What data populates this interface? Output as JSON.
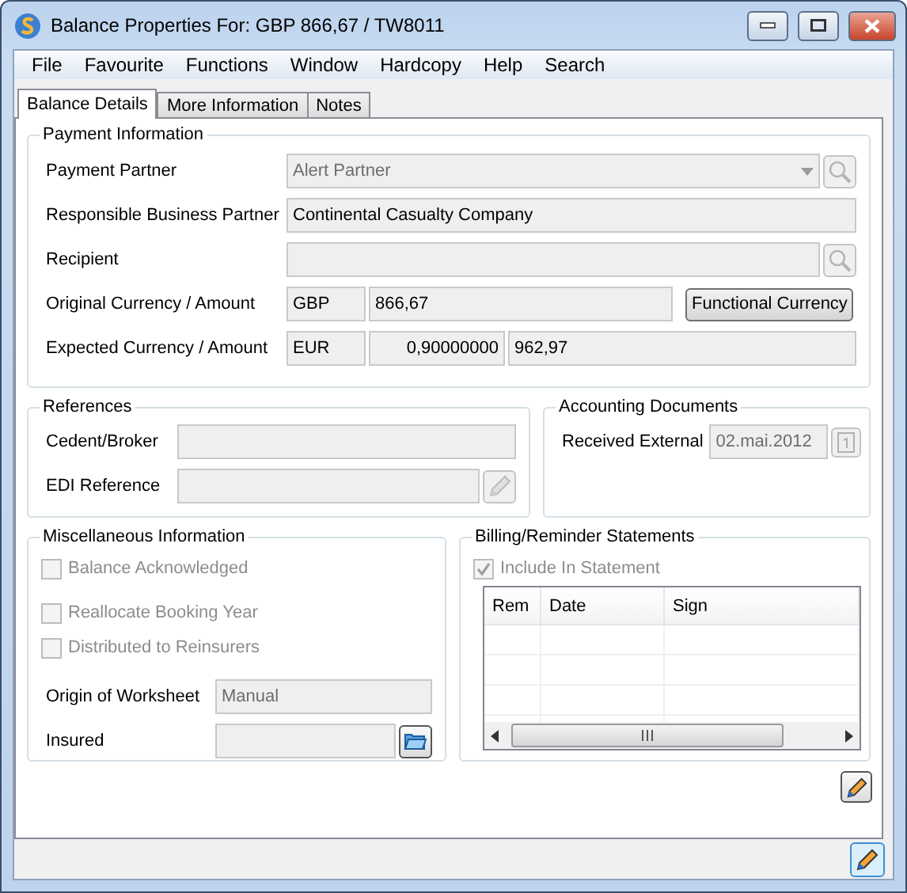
{
  "window": {
    "title": "Balance Properties For: GBP 866,67 / TW8011"
  },
  "menu": [
    "File",
    "Favourite",
    "Functions",
    "Window",
    "Hardcopy",
    "Help",
    "Search"
  ],
  "tabs": [
    {
      "label": "Balance Details",
      "selected": true
    },
    {
      "label": "More Information",
      "selected": false
    },
    {
      "label": "Notes",
      "selected": false
    }
  ],
  "payment_information": {
    "title": "Payment Information",
    "payment_partner": {
      "label": "Payment Partner",
      "value": "Alert Partner",
      "disabled": true
    },
    "responsible_business_partner": {
      "label": "Responsible Business Partner",
      "value": "Continental Casualty Company",
      "disabled": false
    },
    "recipient": {
      "label": "Recipient"
    },
    "original_currency": {
      "label": "Original Currency / Amount",
      "currency": "GBP",
      "amount": "866,67",
      "button": "Functional Currency"
    },
    "expected_currency": {
      "label": "Expected Currency / Amount",
      "currency": "EUR",
      "rate": "0,90000000",
      "amount": "962,97"
    }
  },
  "references": {
    "title": "References",
    "cedent_broker": {
      "label": "Cedent/Broker"
    },
    "edi_reference": {
      "label": "EDI Reference"
    }
  },
  "accounting_documents": {
    "title": "Accounting Documents",
    "received_external": {
      "label": "Received External",
      "value": "02.mai.2012",
      "disabled": true
    }
  },
  "miscellaneous": {
    "title": "Miscellaneous Information",
    "checkboxes": [
      {
        "label": "Balance Acknowledged",
        "checked": false,
        "disabled": true
      },
      {
        "label": "Reallocate Booking Year",
        "checked": false,
        "disabled": true
      },
      {
        "label": "Distributed to Reinsurers",
        "checked": false,
        "disabled": true
      }
    ],
    "origin_of_worksheet": {
      "label": "Origin of Worksheet",
      "value": "Manual",
      "disabled": true
    },
    "insured": {
      "label": "Insured"
    }
  },
  "billing": {
    "title": "Billing/Reminder Statements",
    "include_in_statement": {
      "label": "Include In Statement",
      "checked": true,
      "disabled": true
    },
    "table": {
      "columns": [
        "Rem",
        "Date",
        "Sign"
      ]
    }
  }
}
